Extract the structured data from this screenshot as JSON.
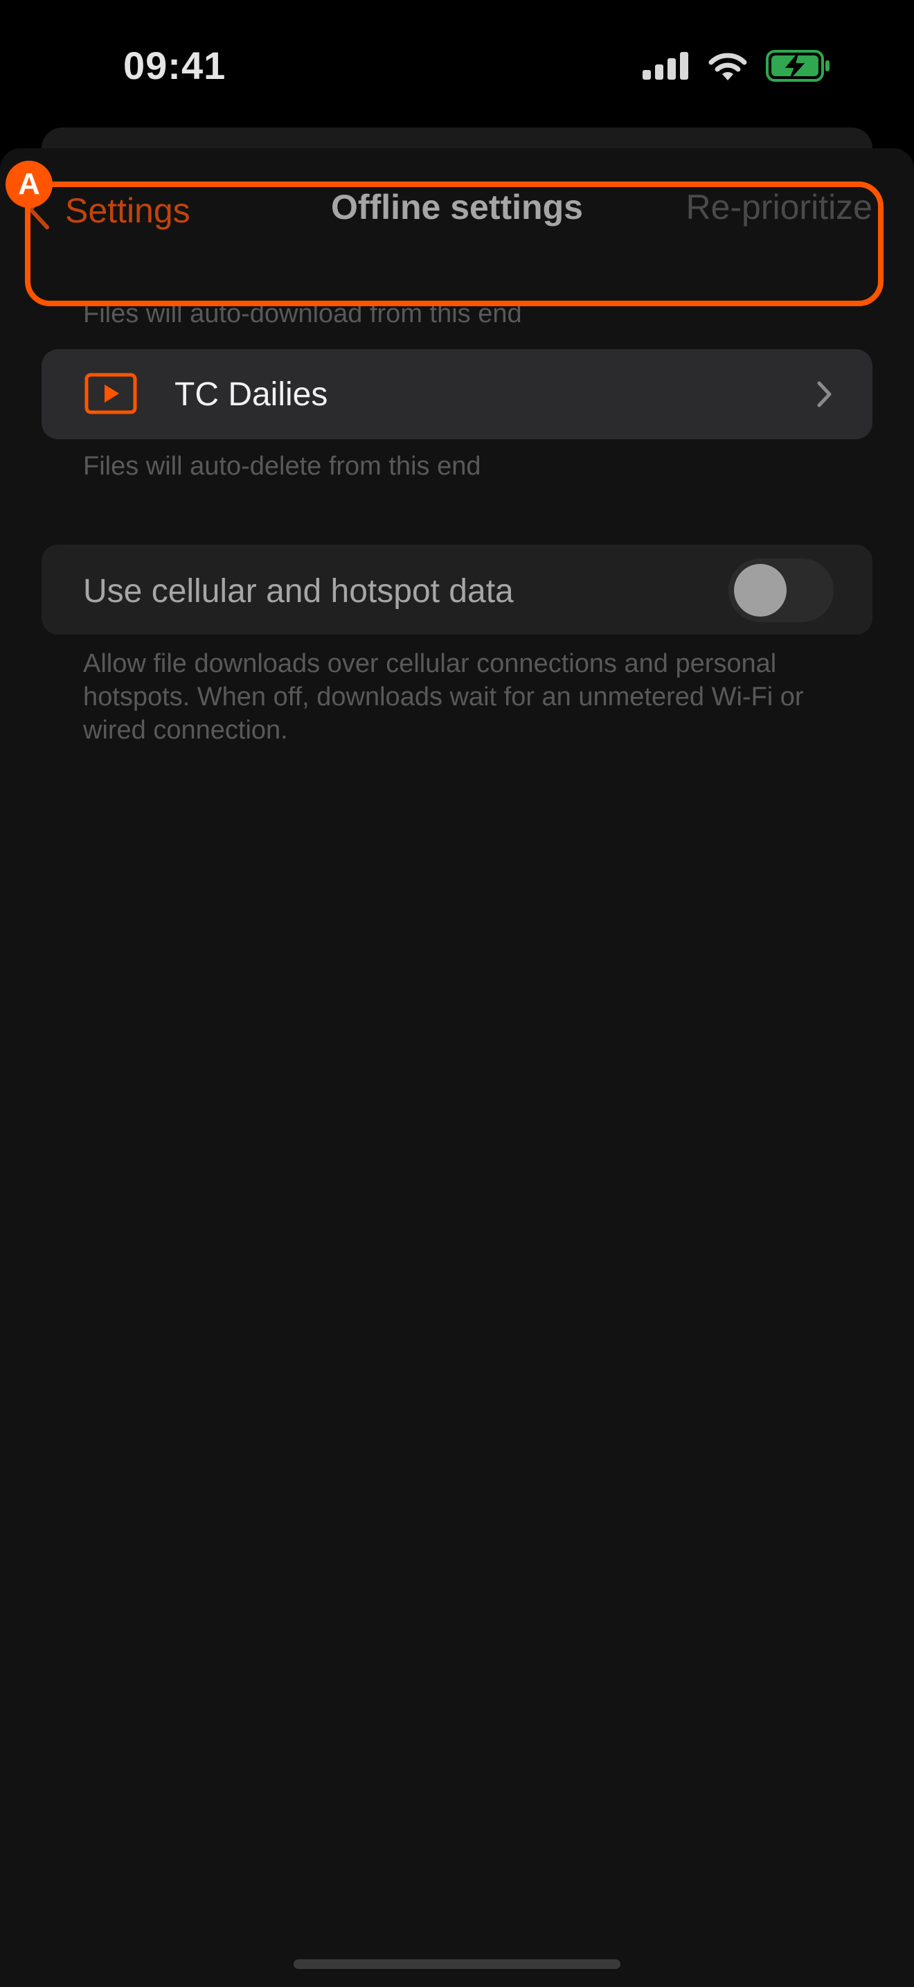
{
  "status_bar": {
    "time": "09:41",
    "icons": [
      "cellular-signal-icon",
      "wifi-icon",
      "battery-charging-icon"
    ],
    "battery_color": "#2fa84f"
  },
  "nav": {
    "back_label": "Settings",
    "title": "Offline settings",
    "action_label": "Re-prioritize"
  },
  "download_section": {
    "top_caption": "Files will auto-download from this end",
    "item_label": "TC Dailies",
    "item_icon": "play-icon",
    "bottom_caption": "Files will auto-delete from this end"
  },
  "annotation": {
    "badge_label": "A",
    "color": "#ff5500"
  },
  "cellular_section": {
    "label": "Use cellular and hotspot data",
    "toggle_on": false,
    "footer": "Allow file downloads over cellular connections and personal hotspots. When off, downloads wait for an unmetered Wi-Fi or wired connection."
  },
  "colors": {
    "accent": "#c2440c",
    "background": "#121212"
  }
}
